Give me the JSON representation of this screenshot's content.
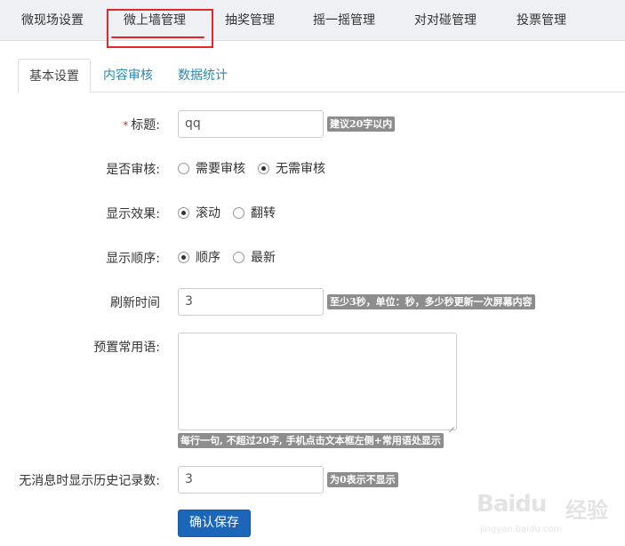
{
  "topnav": {
    "items": [
      "微现场设置",
      "微上墙管理",
      "抽奖管理",
      "摇一摇管理",
      "对对碰管理",
      "投票管理"
    ],
    "active_index": 1
  },
  "subtabs": [
    "基本设置",
    "内容审核",
    "数据统计"
  ],
  "form": {
    "title": {
      "required_mark": "*",
      "label": "标题:",
      "value": "qq",
      "hint": "建议20字以内"
    },
    "review": {
      "label": "是否审核:",
      "options": [
        "需要审核",
        "无需审核"
      ],
      "selected": 1
    },
    "effect": {
      "label": "显示效果:",
      "options": [
        "滚动",
        "翻转"
      ],
      "selected": 0
    },
    "order": {
      "label": "显示顺序:",
      "options": [
        "顺序",
        "最新"
      ],
      "selected": 0
    },
    "refresh": {
      "label": "刷新时间",
      "value": "3",
      "hint": "至少3秒，单位：秒，多少秒更新一次屏幕内容"
    },
    "phrases": {
      "label": "预置常用语:",
      "value": "",
      "hint": "每行一句, 不超过20字, 手机点击文本框左侧+常用语处显示"
    },
    "history": {
      "label": "无消息时显示历史记录数:",
      "value": "3",
      "hint": "为0表示不显示"
    },
    "save_label": "确认保存"
  },
  "watermark": {
    "logo": "Baidu",
    "cn": "经验",
    "url": "jingyan.baidu.com"
  },
  "colors": {
    "accent": "#1b66b8",
    "highlight": "#e3262a",
    "link": "#2a8ab0",
    "hint_bg": "#8d8d8d"
  }
}
